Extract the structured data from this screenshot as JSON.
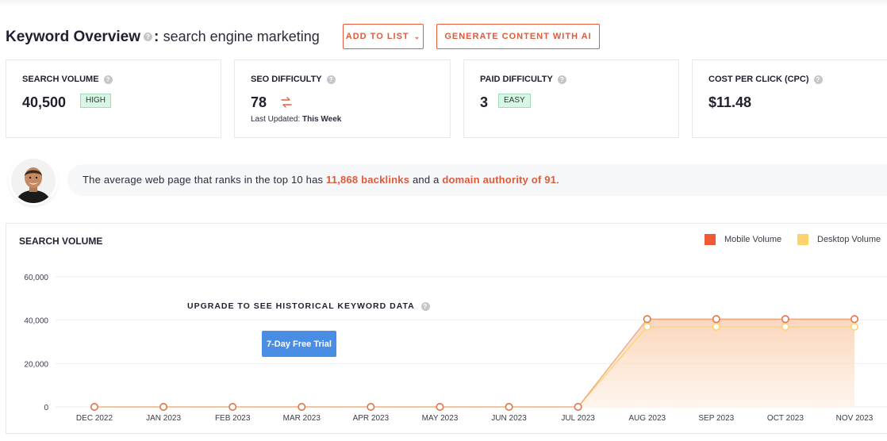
{
  "header": {
    "title": "Keyword Overview",
    "separator": ":",
    "keyword": "search engine marketing",
    "add_to_list_label": "ADD TO LIST",
    "generate_label": "GENERATE CONTENT WITH AI"
  },
  "metrics": {
    "search_volume": {
      "label": "SEARCH VOLUME",
      "value": "40,500",
      "badge": "HIGH"
    },
    "seo_difficulty": {
      "label": "SEO DIFFICULTY",
      "value": "78",
      "updated_label": "Last Updated:",
      "updated_value": "This Week"
    },
    "paid_difficulty": {
      "label": "PAID DIFFICULTY",
      "value": "3",
      "badge": "EASY"
    },
    "cpc": {
      "label": "COST PER CLICK (CPC)",
      "value": "$11.48"
    }
  },
  "insight": {
    "prefix": "The average web page that ranks in the top 10 has ",
    "backlinks": "11,868 backlinks",
    "middle": " and a ",
    "authority": "domain authority of 91",
    "suffix": "."
  },
  "upgrade": {
    "text": "UPGRADE TO SEE HISTORICAL KEYWORD DATA",
    "trial_label": "7-Day Free Trial"
  },
  "colors": {
    "accent": "#e85c3c",
    "mobile": "#ee5a36",
    "desktop": "#fcd36e",
    "trial_button": "#4a8de5",
    "badge_bg": "#d8f5e6"
  },
  "chart_data": {
    "type": "area",
    "title": "SEARCH VOLUME",
    "categories": [
      "DEC 2022",
      "JAN 2023",
      "FEB 2023",
      "MAR 2023",
      "APR 2023",
      "MAY 2023",
      "JUN 2023",
      "JUL 2023",
      "AUG 2023",
      "SEP 2023",
      "OCT 2023",
      "NOV 2023"
    ],
    "series": [
      {
        "name": "Mobile Volume",
        "color": "#ee5a36",
        "values": [
          0,
          0,
          0,
          0,
          0,
          0,
          0,
          0,
          40500,
          40500,
          40500,
          40500
        ]
      },
      {
        "name": "Desktop Volume",
        "color": "#fcd36e",
        "values": [
          0,
          0,
          0,
          0,
          0,
          0,
          0,
          0,
          37000,
          37000,
          37000,
          37000
        ]
      }
    ],
    "y_ticks": [
      "0",
      "20,000",
      "40,000",
      "60,000"
    ],
    "y_tick_values": [
      0,
      20000,
      40000,
      60000
    ],
    "ylim": [
      0,
      60000
    ],
    "grid": true,
    "legend": "top-right"
  }
}
